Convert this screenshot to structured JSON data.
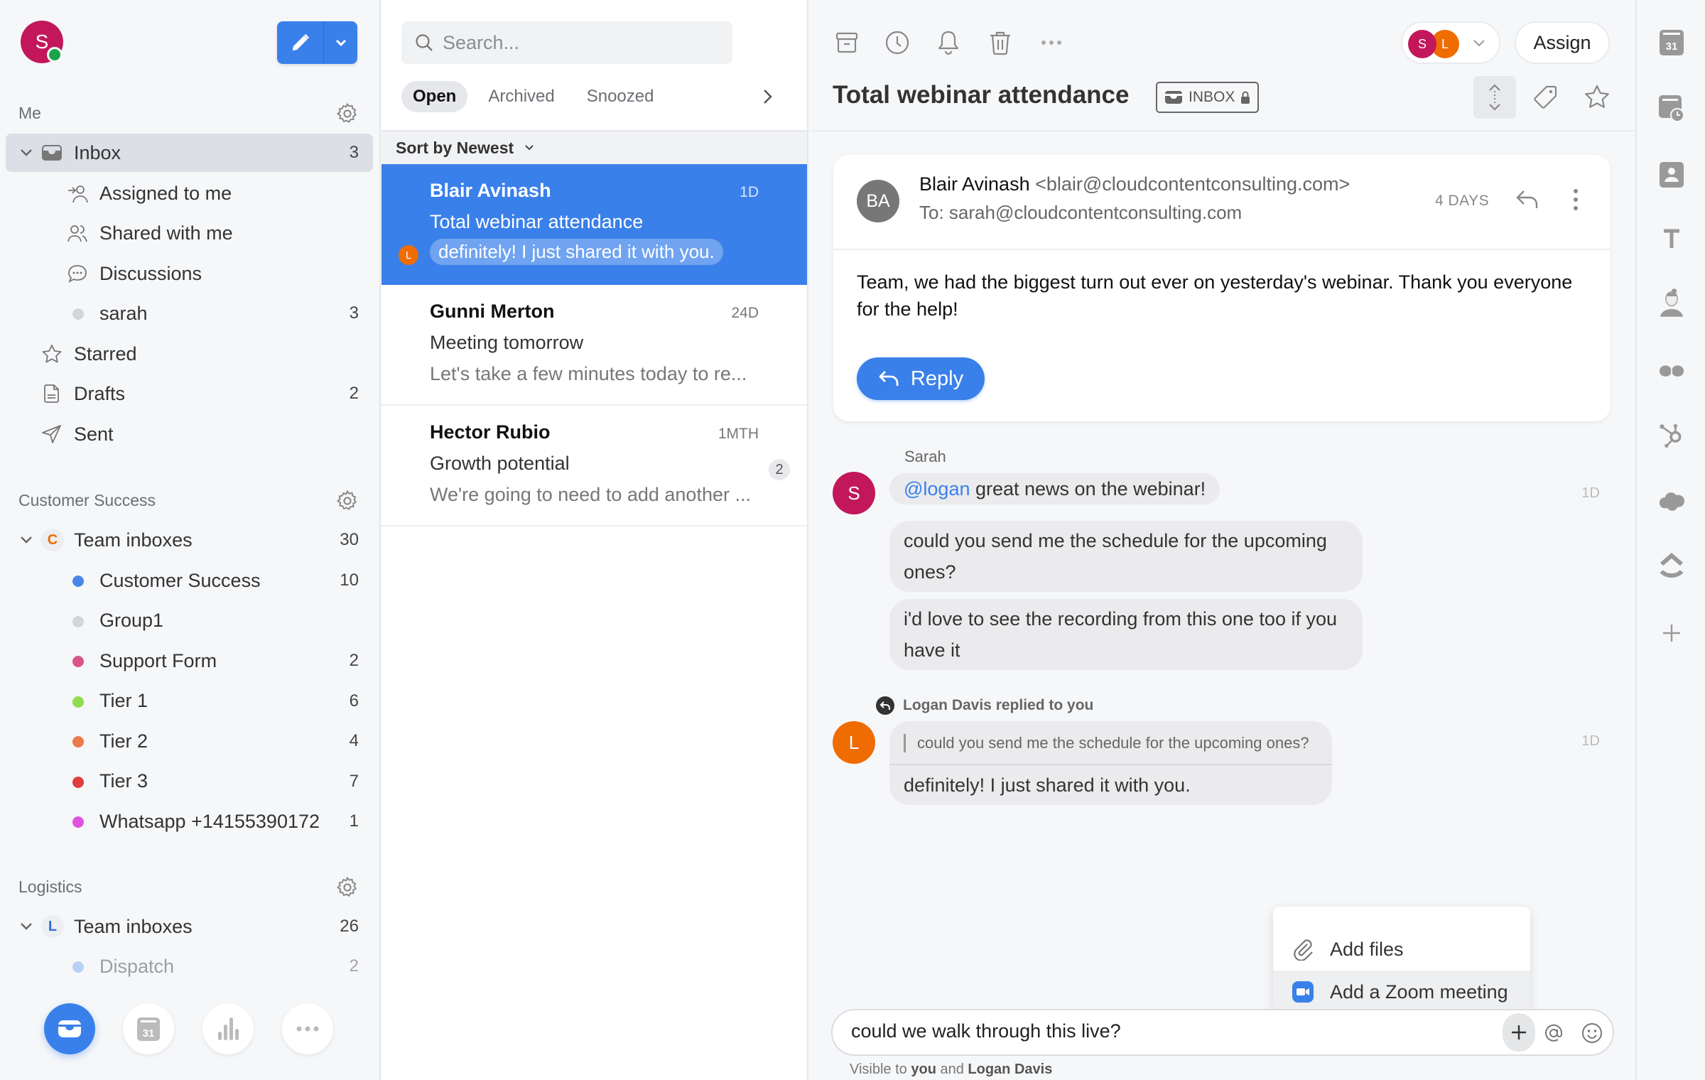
{
  "sidebar": {
    "user_initial": "S",
    "sections": {
      "me": {
        "title": "Me"
      },
      "customer_success": {
        "title": "Customer Success"
      },
      "logistics": {
        "title": "Logistics"
      }
    },
    "me_items": [
      {
        "label": "Inbox",
        "count": "3",
        "icon": "inbox-icon"
      },
      {
        "label": "Assigned to me",
        "count": "",
        "icon": "assigned-icon"
      },
      {
        "label": "Shared with me",
        "count": "",
        "icon": "shared-icon"
      },
      {
        "label": "Discussions",
        "count": "",
        "icon": "discussions-icon"
      },
      {
        "label": "sarah",
        "count": "3",
        "icon": "dot"
      },
      {
        "label": "Starred",
        "count": "",
        "icon": "star-icon"
      },
      {
        "label": "Drafts",
        "count": "2",
        "icon": "drafts-icon"
      },
      {
        "label": "Sent",
        "count": "",
        "icon": "sent-icon"
      }
    ],
    "cs_team": {
      "badge": "C",
      "label": "Team inboxes",
      "count": "30"
    },
    "cs_items": [
      {
        "label": "Customer Success",
        "count": "10",
        "color": "#4a86e8"
      },
      {
        "label": "Group1",
        "count": "",
        "color": "#d4d5d8"
      },
      {
        "label": "Support Form",
        "count": "2",
        "color": "#d9568a"
      },
      {
        "label": "Tier 1",
        "count": "6",
        "color": "#8fdc4e"
      },
      {
        "label": "Tier 2",
        "count": "4",
        "color": "#ea7b4a"
      },
      {
        "label": "Tier 3",
        "count": "7",
        "color": "#de3e3e"
      },
      {
        "label": "Whatsapp +14155390172",
        "count": "1",
        "color": "#e052e0"
      }
    ],
    "log_team": {
      "badge": "L",
      "label": "Team inboxes",
      "count": "26"
    },
    "log_items": [
      {
        "label": "Dispatch",
        "count": "2",
        "color": "#a9c6f5"
      }
    ],
    "calendar_day": "31"
  },
  "convlist": {
    "search_placeholder": "Search...",
    "tabs": [
      "Open",
      "Archived",
      "Snoozed"
    ],
    "sort_label": "Sort by Newest",
    "conversations": [
      {
        "name": "Blair Avinash",
        "time": "1D",
        "subject": "Total webinar attendance",
        "preview": "definitely! I just shared it with you.",
        "avatar": "L",
        "selected": true
      },
      {
        "name": "Gunni Merton",
        "time": "24D",
        "subject": "Meeting tomorrow",
        "preview": "Let's take a few minutes today to re..."
      },
      {
        "name": "Hector Rubio",
        "time": "1MTH",
        "subject": "Growth potential",
        "preview": "We're going to need to add another ...",
        "count": "2"
      }
    ]
  },
  "thread": {
    "title": "Total webinar attendance",
    "inbox_tag": "INBOX",
    "assign_label": "Assign",
    "assignees": [
      "S",
      "L"
    ],
    "email": {
      "initials": "BA",
      "from_name": "Blair Avinash",
      "from_addr": "<blair@cloudcontentconsulting.com>",
      "to": "To: sarah@cloudcontentconsulting.com",
      "age": "4 DAYS",
      "body": "Team, we had the biggest turn out ever on yesterday's webinar. Thank you everyone for the help!",
      "reply_label": "Reply"
    },
    "comments": {
      "sarah_name": "Sarah",
      "sarah_initial": "S",
      "mention": "@logan",
      "msg1": " great news on the webinar!",
      "msg2": "could you send me the schedule for the upcoming ones?",
      "msg3": "i'd love to see the recording from this one too if you have it",
      "time1": "1D",
      "replied_label": "Logan Davis replied to you",
      "logan_initial": "L",
      "quote": "could you send me the schedule for the upcoming ones?",
      "answer": "definitely! I just shared it with you.",
      "time2": "1D"
    },
    "popup": {
      "add_files": "Add files",
      "add_zoom": "Add a Zoom meeting"
    },
    "composer": {
      "value": "could we walk through this live?",
      "visible_prefix": "Visible to ",
      "visible_you": "you",
      "visible_and": " and ",
      "visible_other": "Logan Davis"
    }
  },
  "colors": {
    "accent": "#3a80ea",
    "sarah": "#c2185b",
    "logan": "#ef6c00",
    "online": "#1aa34a"
  }
}
